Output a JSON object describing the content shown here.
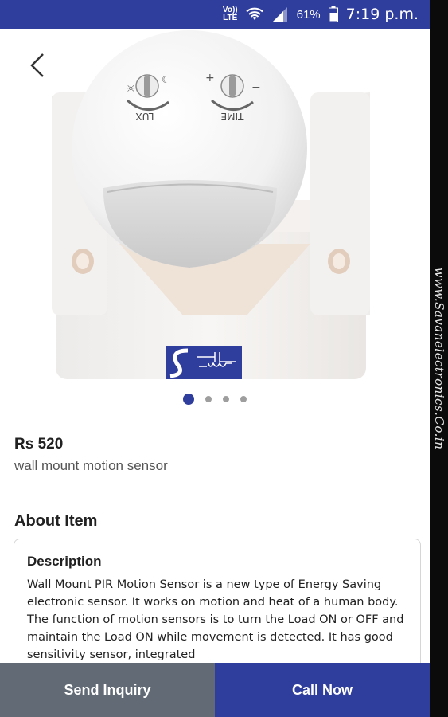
{
  "status_bar": {
    "volte_line1": "Vo))",
    "volte_line2": "LTE",
    "battery_percent": "61%",
    "time": "7:19 p.m."
  },
  "watermark": "www.Savanelectronics.Co.in",
  "product_image": {
    "lux_label": "LUX",
    "time_label": "TIME",
    "carousel_total": 4,
    "carousel_active": 1
  },
  "product": {
    "price": "Rs 520",
    "name": "wall mount motion sensor"
  },
  "about": {
    "title": "About Item",
    "description_title": "Description",
    "description_text": "Wall Mount PIR Motion Sensor is a new type of Energy Saving electronic sensor. It works on motion and heat of a human body. The function of motion sensors is to turn the Load ON or OFF and maintain the Load ON while movement is detected. It has good sensitivity sensor, integrated"
  },
  "actions": {
    "send_inquiry": "Send Inquiry",
    "call_now": "Call Now"
  },
  "colors": {
    "primary": "#2f3d9c",
    "secondary_button": "#616a75"
  }
}
